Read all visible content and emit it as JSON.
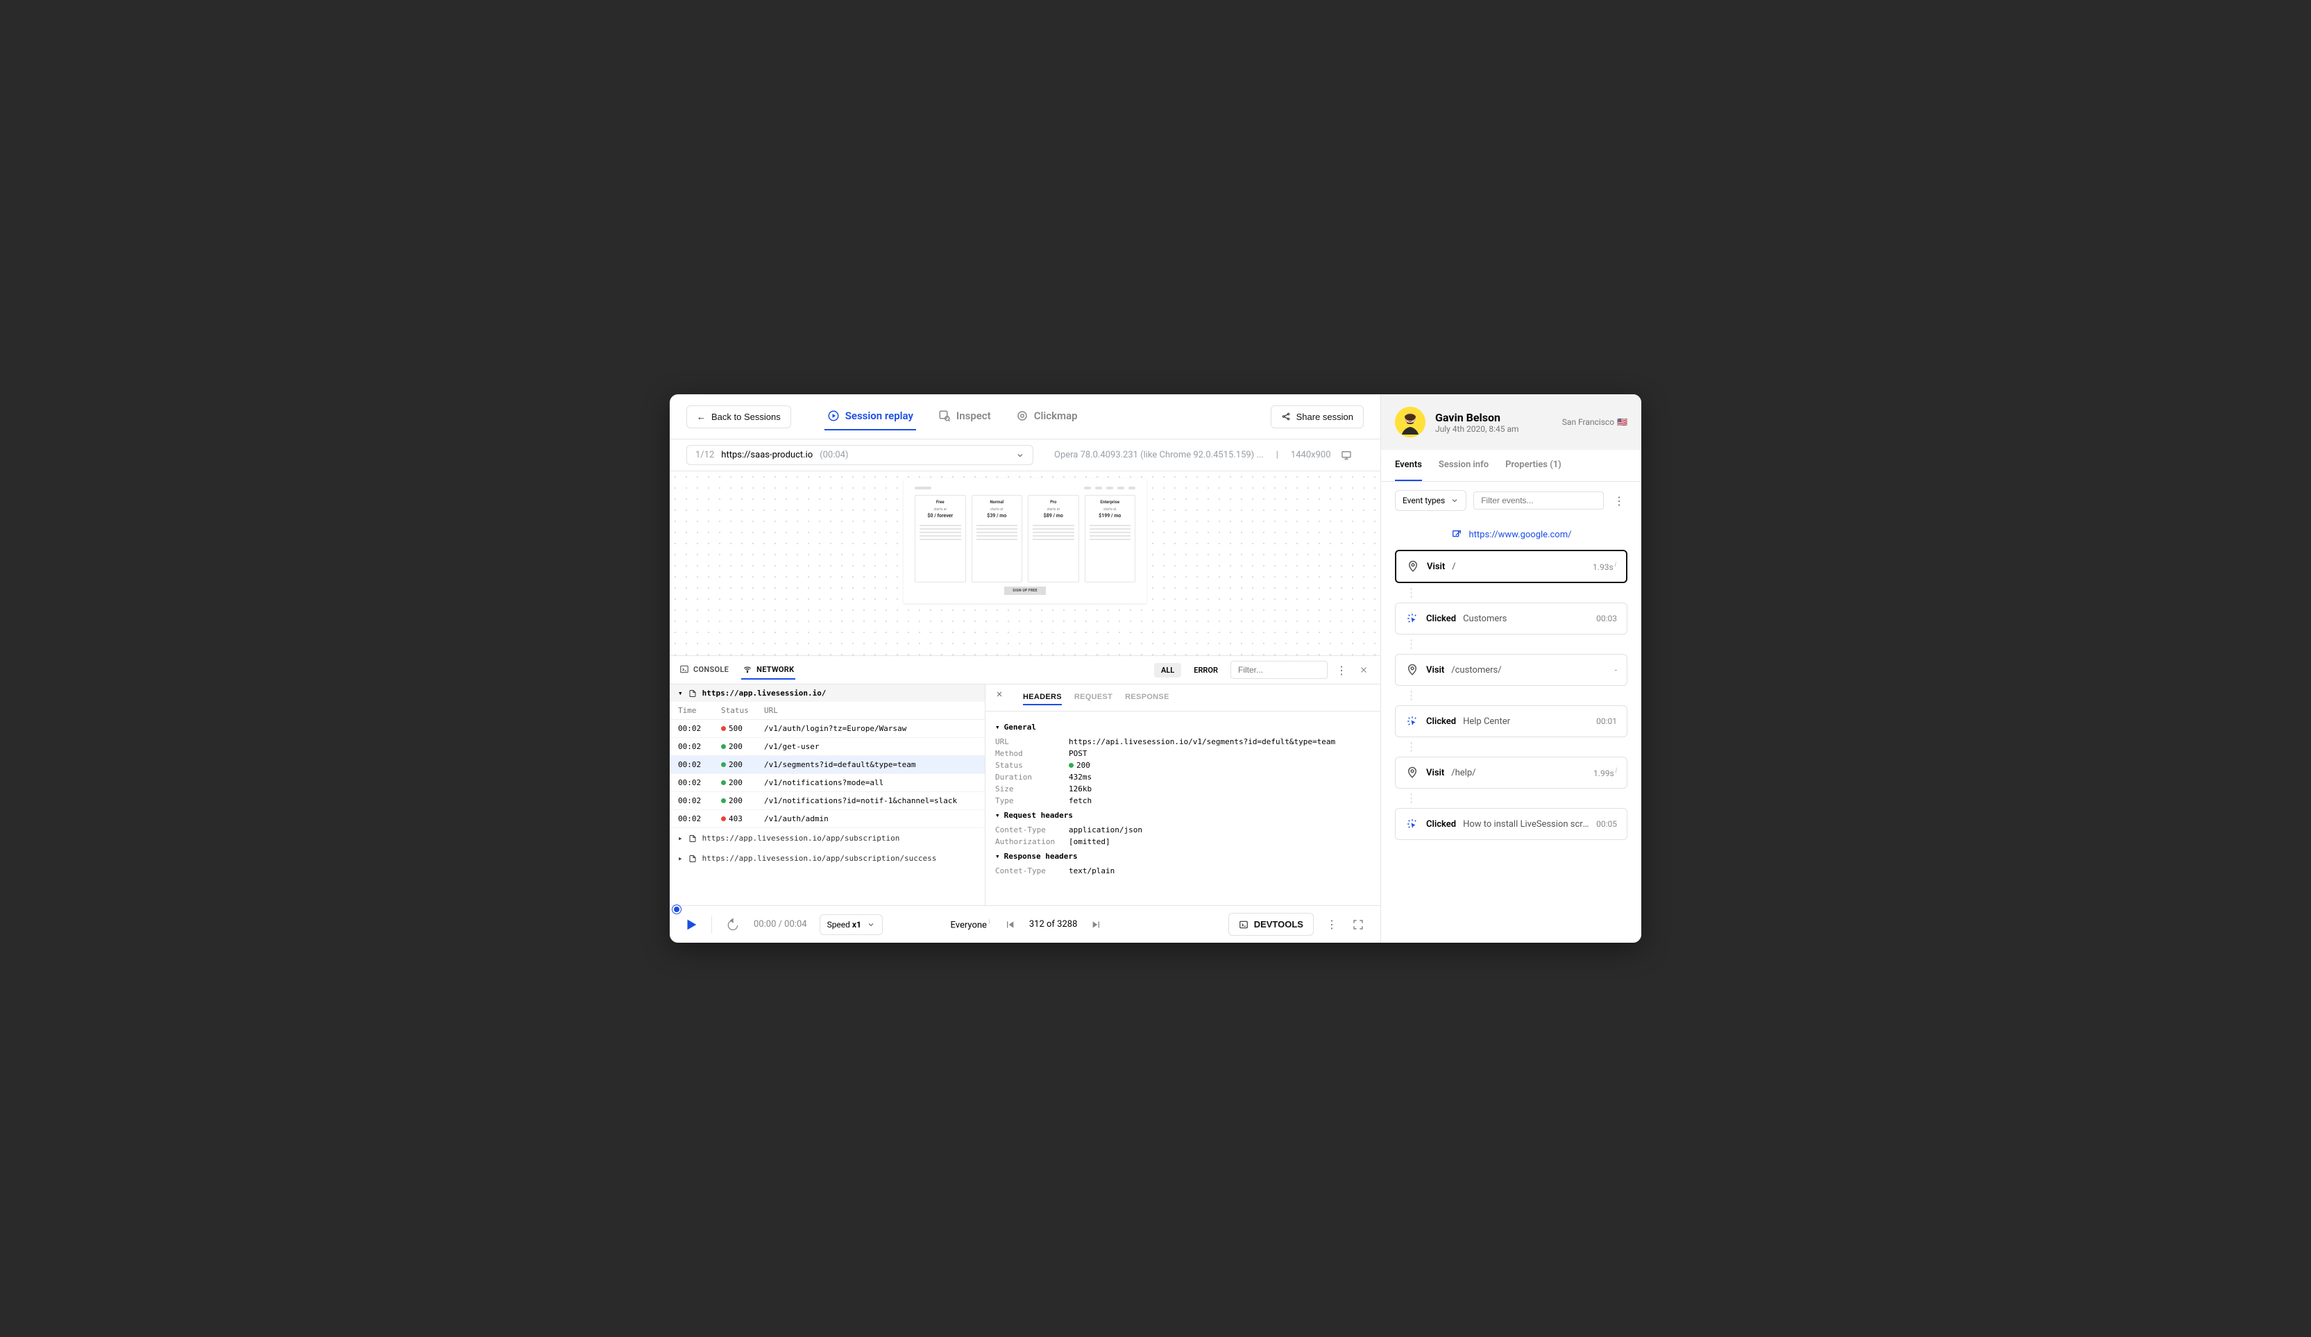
{
  "header": {
    "back_label": "Back to Sessions",
    "tabs": [
      {
        "label": "Session replay",
        "active": true
      },
      {
        "label": "Inspect",
        "active": false
      },
      {
        "label": "Clickmap",
        "active": false
      }
    ],
    "share_label": "Share session"
  },
  "urlbar": {
    "counter": "1/12",
    "url": "https://saas-product.io",
    "time": "(00:04)",
    "browser": "Opera 78.0.4093.231 (like Chrome 92.0.4515.159) ...",
    "resolution": "1440x900"
  },
  "page_preview": {
    "plans": [
      {
        "name": "Free",
        "sub": "starts at",
        "price": "$0 / forever"
      },
      {
        "name": "Normal",
        "sub": "starts at",
        "price": "$39 / mo"
      },
      {
        "name": "Pro",
        "sub": "starts at",
        "price": "$89 / mo"
      },
      {
        "name": "Enterprise",
        "sub": "starts at",
        "price": "$199 / mo"
      }
    ],
    "cta": "SIGN UP FREE"
  },
  "devtools": {
    "tabs": {
      "console": "CONSOLE",
      "network": "NETWORK"
    },
    "filters": {
      "all": "ALL",
      "error": "ERROR",
      "placeholder": "Filter..."
    },
    "group_url": "https://app.livesession.io/",
    "columns": {
      "time": "Time",
      "status": "Status",
      "url": "URL"
    },
    "rows": [
      {
        "time": "00:02",
        "status": "500",
        "ok": false,
        "url": "/v1/auth/login?tz=Europe/Warsaw",
        "selected": false
      },
      {
        "time": "00:02",
        "status": "200",
        "ok": true,
        "url": "/v1/get-user",
        "selected": false
      },
      {
        "time": "00:02",
        "status": "200",
        "ok": true,
        "url": "/v1/segments?id=default&type=team",
        "selected": true
      },
      {
        "time": "00:02",
        "status": "200",
        "ok": true,
        "url": "/v1/notifications?mode=all",
        "selected": false
      },
      {
        "time": "00:02",
        "status": "200",
        "ok": true,
        "url": "/v1/notifications?id=notif-1&channel=slack",
        "selected": false
      },
      {
        "time": "00:02",
        "status": "403",
        "ok": false,
        "url": "/v1/auth/admin",
        "selected": false
      }
    ],
    "collapsed_groups": [
      "https://app.livesession.io/app/subscription",
      "https://app.livesession.io/app/subscription/success"
    ],
    "detail_tabs": {
      "headers": "HEADERS",
      "request": "REQUEST",
      "response": "RESPONSE"
    },
    "detail": {
      "general_label": "General",
      "general": {
        "url_k": "URL",
        "url_v": "https://api.livesession.io/v1/segments?id=defult&type=team",
        "method_k": "Method",
        "method_v": "POST",
        "status_k": "Status",
        "status_v": "200",
        "duration_k": "Duration",
        "duration_v": "432ms",
        "size_k": "Size",
        "size_v": "126kb",
        "type_k": "Type",
        "type_v": "fetch"
      },
      "req_label": "Request headers",
      "req": {
        "ct_k": "Contet-Type",
        "ct_v": "application/json",
        "auth_k": "Authorization",
        "auth_v": "[omitted]"
      },
      "res_label": "Response headers",
      "res": {
        "ct_k": "Contet-Type",
        "ct_v": "text/plain"
      }
    }
  },
  "playbar": {
    "time": "00:00 / 00:04",
    "speed_label": "Speed ",
    "speed_value": "x1",
    "everyone": "Everyone",
    "position": "312 of 3288",
    "devtools_btn": "DEVTOOLS"
  },
  "sidebar": {
    "user": {
      "name": "Gavin Belson",
      "date": "July 4th 2020, 8:45 am",
      "location": "San Francisco",
      "flag": "🇺🇸"
    },
    "tabs": {
      "events": "Events",
      "session": "Session info",
      "props": "Properties (1)"
    },
    "filter": {
      "types": "Event types",
      "placeholder": "Filter events..."
    },
    "referrer": "https://www.google.com/",
    "events": [
      {
        "type": "Visit",
        "target": "/",
        "time": "1.93s",
        "info": true,
        "selected": true,
        "icon": "pin"
      },
      {
        "type": "Clicked",
        "target": "Customers",
        "time": "00:03",
        "info": false,
        "icon": "click"
      },
      {
        "type": "Visit",
        "target": "/customers/",
        "time": "-",
        "info": false,
        "icon": "pin"
      },
      {
        "type": "Clicked",
        "target": "Help Center",
        "time": "00:01",
        "info": false,
        "icon": "click"
      },
      {
        "type": "Visit",
        "target": "/help/",
        "time": "1.99s",
        "info": true,
        "icon": "pin"
      },
      {
        "type": "Clicked",
        "target": "How to install LiveSession script on...",
        "time": "00:05",
        "info": false,
        "icon": "click"
      }
    ]
  }
}
